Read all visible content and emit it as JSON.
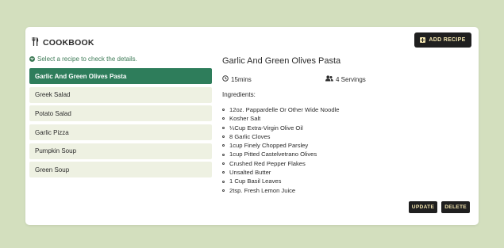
{
  "app": {
    "title": "COOKBOOK",
    "icon": "utensils-icon"
  },
  "header": {
    "add_recipe_label": "ADD RECIPE"
  },
  "sidebar": {
    "hint": "Select a recipe to check the details.",
    "recipes": [
      "Garlic And Green Olives Pasta",
      "Greek Salad",
      "Potato Salad",
      "Garlic Pizza",
      "Pumpkin Soup",
      "Green Soup"
    ],
    "selected_index": 0
  },
  "detail": {
    "title": "Garlic And Green Olives Pasta",
    "time": "15mins",
    "servings": "4 Servings",
    "ingredients_label": "Ingredients:",
    "ingredients": [
      "12oz. Pappardelle Or Other Wide Noodle",
      "Kosher Salt",
      "¼Cup Extra-Virgin Olive Oil",
      "8 Garlic Cloves",
      "1cup Finely Chopped Parsley",
      "1cup Pitted Castelvetrano Olives",
      "Crushed Red Pepper Flakes",
      "Unsalted Butter",
      "1 Cup Basil Leaves",
      "2tsp. Fresh Lemon Juice"
    ],
    "update_label": "UPDATE",
    "delete_label": "DELETE"
  },
  "colors": {
    "background": "#d3dfbe",
    "accent": "#2e7d5b",
    "button": "#1f1f1f",
    "button_text": "#f3e6b0"
  }
}
